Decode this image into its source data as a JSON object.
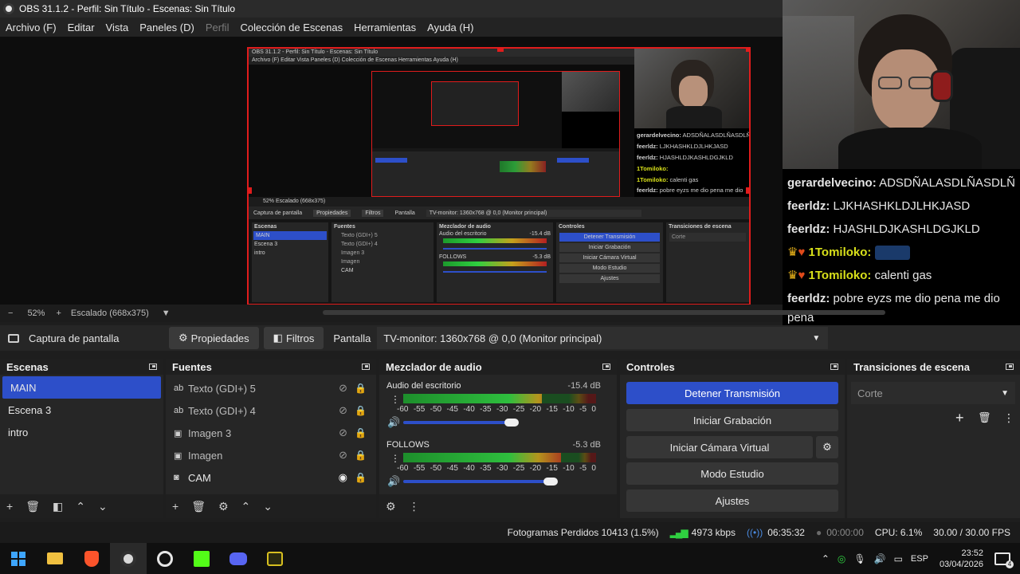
{
  "window": {
    "title": "OBS 31.1.2 - Perfil: Sin Título - Escenas: Sin Título"
  },
  "menu": [
    {
      "label": "Archivo (F)",
      "disabled": false
    },
    {
      "label": "Editar",
      "disabled": false
    },
    {
      "label": "Vista",
      "disabled": false
    },
    {
      "label": "Paneles (D)",
      "disabled": false
    },
    {
      "label": "Perfil",
      "disabled": true
    },
    {
      "label": "Colección de Escenas",
      "disabled": false
    },
    {
      "label": "Herramientas",
      "disabled": false
    },
    {
      "label": "Ayuda (H)",
      "disabled": false
    }
  ],
  "mini": {
    "title": "OBS 31.1.2 - Perfil: Sin Título - Escenas: Sin Título",
    "menu": "Archivo (F)   Editar   Vista   Paneles (D)   Colección de Escenas   Herramientas   Ayuda (H)",
    "chat": [
      {
        "user": "gerardelvecino:",
        "msg": "ADSDÑALASDLÑASDLÑA"
      },
      {
        "user": "feerldz:",
        "msg": "LJKHASHKLDJLHKJASD"
      },
      {
        "user": "feerldz:",
        "msg": "HJASHLDJKASHLDGJKLD"
      },
      {
        "user": "1Tomiloko:",
        "msg": ""
      },
      {
        "user": "1Tomiloko:",
        "msg": "calenti gas"
      },
      {
        "user": "feerldz:",
        "msg": "pobre eyzs me dio pena me dio pena"
      }
    ],
    "status": "52%   Escalado (668x375)",
    "sourcebar": {
      "capture": "Captura de pantalla",
      "props": "Propiedades",
      "filters": "Filtros",
      "screen": "Pantalla",
      "monitor": "TV-monitor: 1360x768 @ 0,0 (Monitor principal)"
    },
    "docks": {
      "scenes": "Escenas",
      "sources": "Fuentes",
      "mixer": "Mezclador de audio",
      "controls": "Controles",
      "transitions": "Transiciones de escena"
    },
    "scenes": [
      "MAIN",
      "Escena 3",
      "intro"
    ],
    "sources": [
      "Texto (GDI+) 5",
      "Texto (GDI+) 4",
      "Imagen 3",
      "Imagen",
      "CAM"
    ],
    "mixer": {
      "ch1": "Audio del escritorio",
      "ch1_db": "-15.4 dB",
      "ch2": "FOLLOWS",
      "ch2_db": "-5.3 dB"
    },
    "controls": [
      "Detener Transmisión",
      "Iniciar Grabación",
      "Iniciar Cámara Virtual",
      "Modo Estudio",
      "Ajustes"
    ],
    "transition": "Corte"
  },
  "chat": [
    {
      "user": "gerardelvecino:",
      "color": "#e6e6e6",
      "msg": "ADSDÑALASDLÑASDLÑDA",
      "badges": false
    },
    {
      "user": "feerldz:",
      "color": "#e6e6e6",
      "msg": "LJKHASHKLDJLHKJASD",
      "badges": false
    },
    {
      "user": "feerldz:",
      "color": "#e6e6e6",
      "msg": "HJASHLDJKASHLDGJKLD",
      "badges": false
    },
    {
      "user": "1Tomiloko:",
      "color": "#d8e01a",
      "msg": "",
      "badges": true
    },
    {
      "user": "1Tomiloko:",
      "color": "#d8e01a",
      "msg": "calenti gas",
      "badges": true
    },
    {
      "user": "feerldz:",
      "color": "#e6e6e6",
      "msg": "pobre eyzs me dio pena me dio",
      "badges": false
    },
    {
      "user": "",
      "color": "#e6e6e6",
      "msg": "pena",
      "badges": false
    }
  ],
  "preview_status": {
    "zoom": "52%",
    "scale": "Escalado (668x375)"
  },
  "source_bar": {
    "source_name": "Captura de pantalla",
    "properties": "Propiedades",
    "filters": "Filtros",
    "screen_label": "Pantalla",
    "monitor": "TV-monitor: 1360x768 @ 0,0 (Monitor principal)"
  },
  "docks": {
    "scenes": {
      "title": "Escenas",
      "items": [
        "MAIN",
        "Escena 3",
        "intro"
      ],
      "selected": 0
    },
    "sources": {
      "title": "Fuentes",
      "items": [
        {
          "label": "Texto (GDI+) 5",
          "icon": "text-icon",
          "visible": false
        },
        {
          "label": "Texto (GDI+) 4",
          "icon": "text-icon",
          "visible": false
        },
        {
          "label": "Imagen 3",
          "icon": "image-icon",
          "visible": false
        },
        {
          "label": "Imagen",
          "icon": "image-icon",
          "visible": false
        },
        {
          "label": "CAM",
          "icon": "camera-icon",
          "visible": true
        }
      ]
    },
    "mixer": {
      "title": "Mezclador de audio",
      "scale": [
        "-60",
        "-55",
        "-50",
        "-45",
        "-40",
        "-35",
        "-30",
        "-25",
        "-20",
        "-15",
        "-10",
        "-5",
        "0"
      ],
      "channels": [
        {
          "name": "Audio del escritorio",
          "db": "-15.4 dB",
          "level": 0.72,
          "volume": 0.62
        },
        {
          "name": "FOLLOWS",
          "db": "-5.3 dB",
          "level": 0.82,
          "volume": 0.84
        }
      ]
    },
    "controls": {
      "title": "Controles",
      "stop_stream": "Detener Transmisión",
      "start_record": "Iniciar Grabación",
      "virtual_cam": "Iniciar Cámara Virtual",
      "studio_mode": "Modo Estudio",
      "settings": "Ajustes"
    },
    "transitions": {
      "title": "Transiciones de escena",
      "selected": "Corte"
    }
  },
  "statusbar": {
    "dropped_frames": "Fotogramas Perdidos 10413 (1.5%)",
    "bitrate": "4973 kbps",
    "stream_time": "06:35:32",
    "record_time": "00:00:00",
    "cpu": "CPU: 6.1%",
    "fps": "30.00 / 30.00 FPS"
  },
  "taskbar": {
    "lang": "ESP",
    "time": "23:52",
    "date": "03/04/2026",
    "notifications": "4",
    "apps": [
      "windows-start-icon",
      "file-explorer-icon",
      "brave-browser-icon",
      "obs-icon",
      "clock-app-icon",
      "kick-app-icon",
      "discord-icon",
      "game-app-icon"
    ]
  },
  "colors": {
    "accent": "#2d4fc9",
    "selection_border": "#e01c1c",
    "highlight_user": "#d8e01a"
  }
}
